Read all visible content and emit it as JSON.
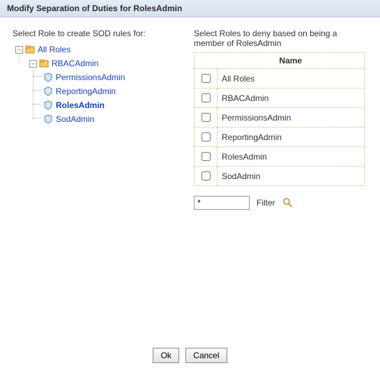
{
  "title": "Modify Separation of Duties for RolesAdmin",
  "left": {
    "label": "Select Role to create SOD rules for:",
    "tree": {
      "root": "All Roles",
      "admin": "RBACAdmin",
      "children": [
        "PermissionsAdmin",
        "ReportingAdmin",
        "RolesAdmin",
        "SodAdmin"
      ],
      "selected": "RolesAdmin"
    }
  },
  "right": {
    "label": "Select Roles to deny based on being a member of RolesAdmin",
    "header": "Name",
    "rows": [
      "All Roles",
      "RBACAdmin",
      "PermissionsAdmin",
      "ReportingAdmin",
      "RolesAdmin",
      "SodAdmin"
    ],
    "filter": {
      "value": "*",
      "label": "Filter"
    }
  },
  "buttons": {
    "ok": "Ok",
    "cancel": "Cancel"
  }
}
